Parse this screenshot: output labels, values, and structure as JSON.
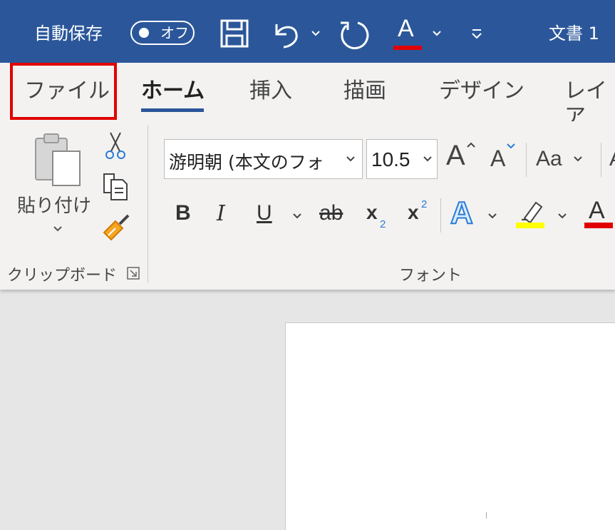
{
  "titlebar": {
    "autosave_label": "自動保存",
    "autosave_state": "オフ",
    "doc_title": "文書 1",
    "font_color_glyph": "A",
    "colors": {
      "background": "#2b579a",
      "font_color_bar": "#e00000"
    }
  },
  "tabs": [
    {
      "label": "ファイル"
    },
    {
      "label": "ホーム",
      "active": true
    },
    {
      "label": "挿入"
    },
    {
      "label": "描画"
    },
    {
      "label": "デザイン"
    },
    {
      "label": "レイア"
    }
  ],
  "clipboard": {
    "paste_label": "貼り付け",
    "group_label": "クリップボード"
  },
  "font_group": {
    "font_name": "游明朝 (本文のフォ",
    "font_size": "10.5",
    "grow_glyph": "A",
    "shrink_glyph": "A",
    "case_glyph": "Aa",
    "bold": "B",
    "italic": "I",
    "underline": "U",
    "strike": "ab",
    "subscript_base": "x",
    "subscript_index": "2",
    "superscript_base": "x",
    "superscript_index": "2",
    "effects_glyph": "A",
    "font_color_glyph": "A",
    "group_label": "フォント",
    "colors": {
      "highlight": "#ffff00",
      "font_color": "#e00000",
      "underline_accent": "#2b579a"
    }
  }
}
